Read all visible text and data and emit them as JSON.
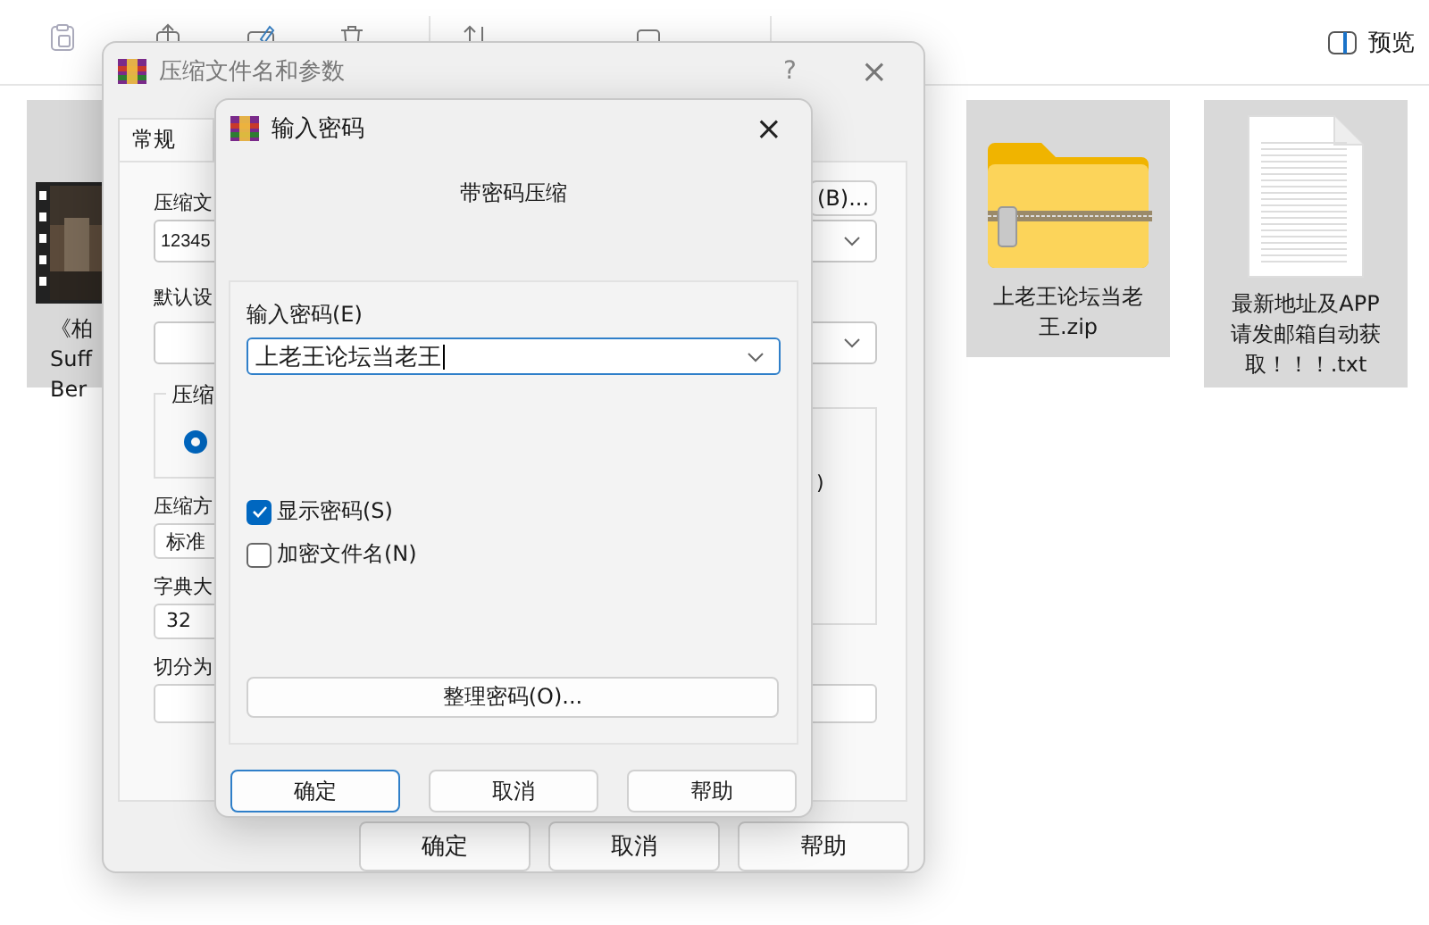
{
  "explorer": {
    "preview_label": "预览",
    "files": [
      {
        "kind": "video",
        "selected": true,
        "label_lines": [
          "《柏",
          "Suff",
          "Ber"
        ]
      },
      {
        "kind": "zip",
        "selected": true,
        "label_lines": [
          "上老王论坛当老",
          "王.zip"
        ]
      },
      {
        "kind": "text",
        "selected": true,
        "label_lines": [
          "最新地址及APP",
          "请发邮箱自动获",
          "取！！！.txt"
        ]
      }
    ]
  },
  "archive_dialog": {
    "title": "压缩文件名和参数",
    "help_glyph": "?",
    "close_glyph": "×",
    "tabs": [
      {
        "label": "常规",
        "selected": true
      }
    ],
    "archive_name_label": "压缩文",
    "browse_button": "(B)...",
    "archive_name_value": "12345",
    "profile_label": "默认设",
    "group_label": "压缩",
    "radio_selected": true,
    "right_group_text": ")",
    "method_label": "压缩方",
    "method_value": "标准",
    "dictionary_label": "字典大",
    "dictionary_value": "32",
    "split_label": "切分为",
    "buttons": [
      {
        "label": "确定"
      },
      {
        "label": "取消"
      },
      {
        "label": "帮助"
      }
    ]
  },
  "password_dialog": {
    "title": "输入密码",
    "close_glyph": "×",
    "heading": "带密码压缩",
    "password_label": "输入密码(E)",
    "password_value": "上老王论坛当老王",
    "options": [
      {
        "label": "显示密码(S)",
        "checked": true
      },
      {
        "label": "加密文件名(N)",
        "checked": false
      }
    ],
    "manage_button": "整理密码(O)...",
    "buttons": [
      {
        "label": "确定",
        "default": true
      },
      {
        "label": "取消",
        "default": false
      },
      {
        "label": "帮助",
        "default": false
      }
    ]
  }
}
